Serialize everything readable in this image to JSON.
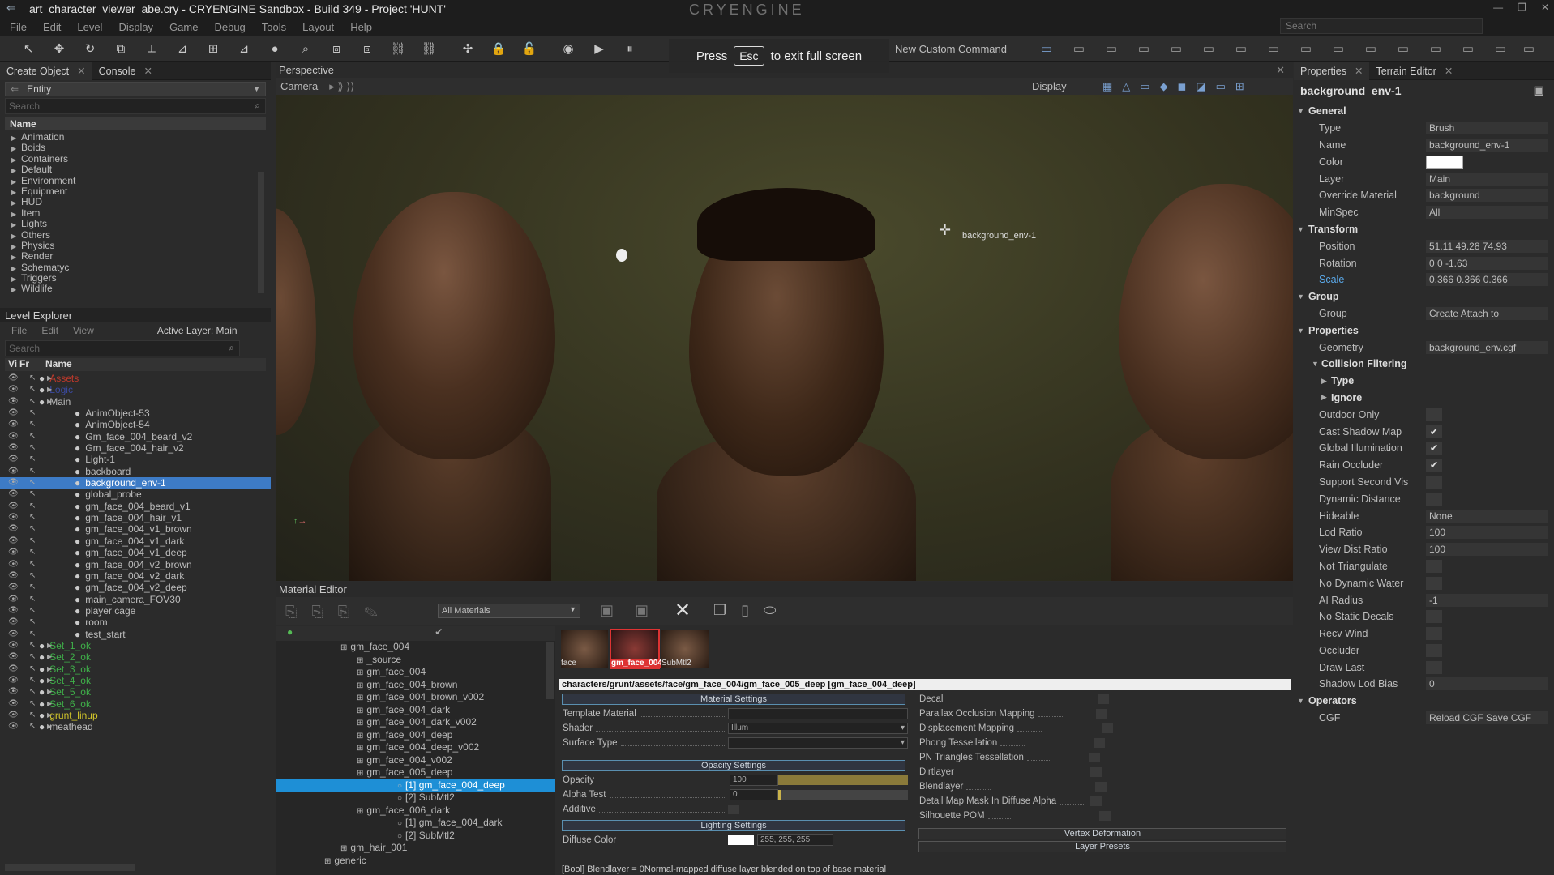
{
  "window": {
    "title": "art_character_viewer_abe.cry - CRYENGINE Sandbox - Build 349 - Project 'HUNT'",
    "logo": "CRYENGINE",
    "search_placeholder": "Search"
  },
  "menu": [
    "File",
    "Edit",
    "Level",
    "Display",
    "Game",
    "Debug",
    "Tools",
    "Layout",
    "Help"
  ],
  "toolbar": {
    "new_custom_command": "New Custom Command"
  },
  "fullscreen": {
    "press": "Press",
    "key": "Esc",
    "msg": "to exit full screen"
  },
  "create_object": {
    "tabs": [
      "Create Object",
      "Console"
    ],
    "dropdown": "Entity",
    "search": "Search",
    "col": "Name",
    "items": [
      "Animation",
      "Boids",
      "Containers",
      "Default",
      "Environment",
      "Equipment",
      "HUD",
      "Item",
      "Lights",
      "Others",
      "Physics",
      "Render",
      "Schematyc",
      "Triggers",
      "Wildlife"
    ]
  },
  "level_explorer": {
    "title": "Level Explorer",
    "menu": [
      "File",
      "Edit",
      "View"
    ],
    "active_layer": "Active Layer: Main",
    "search": "Search",
    "cols": [
      "Vi",
      "Fr",
      "Name"
    ],
    "items": [
      {
        "n": "Assets",
        "d": 0,
        "c": "#c0392b"
      },
      {
        "n": "Logic",
        "d": 0,
        "c": "#3b4aa0"
      },
      {
        "n": "Main",
        "d": 0,
        "c": "#bdbdbd"
      },
      {
        "n": "AnimObject-53",
        "d": 1
      },
      {
        "n": "AnimObject-54",
        "d": 1
      },
      {
        "n": "Gm_face_004_beard_v2",
        "d": 1
      },
      {
        "n": "Gm_face_004_hair_v2",
        "d": 1
      },
      {
        "n": "Light-1",
        "d": 1
      },
      {
        "n": "backboard",
        "d": 1
      },
      {
        "n": "background_env-1",
        "d": 1,
        "sel": true
      },
      {
        "n": "global_probe",
        "d": 1
      },
      {
        "n": "gm_face_004_beard_v1",
        "d": 1
      },
      {
        "n": "gm_face_004_hair_v1",
        "d": 1
      },
      {
        "n": "gm_face_004_v1_brown",
        "d": 1
      },
      {
        "n": "gm_face_004_v1_dark",
        "d": 1
      },
      {
        "n": "gm_face_004_v1_deep",
        "d": 1
      },
      {
        "n": "gm_face_004_v2_brown",
        "d": 1
      },
      {
        "n": "gm_face_004_v2_dark",
        "d": 1
      },
      {
        "n": "gm_face_004_v2_deep",
        "d": 1
      },
      {
        "n": "main_camera_FOV30",
        "d": 1
      },
      {
        "n": "player cage",
        "d": 1
      },
      {
        "n": "room",
        "d": 1
      },
      {
        "n": "test_start",
        "d": 1
      },
      {
        "n": "Set_1_ok",
        "d": 0,
        "c": "#3fae49"
      },
      {
        "n": "Set_2_ok",
        "d": 0,
        "c": "#3fae49"
      },
      {
        "n": "Set_3_ok",
        "d": 0,
        "c": "#3fae49"
      },
      {
        "n": "Set_4_ok",
        "d": 0,
        "c": "#3fae49"
      },
      {
        "n": "Set_5_ok",
        "d": 0,
        "c": "#3fae49"
      },
      {
        "n": "Set_6_ok",
        "d": 0,
        "c": "#3fae49"
      },
      {
        "n": "grunt_linup",
        "d": 0,
        "c": "#d4c72a"
      },
      {
        "n": "meathead",
        "d": 0
      }
    ]
  },
  "viewport": {
    "title": "Perspective",
    "camera": "Camera",
    "display": "Display",
    "label": "background_env-1"
  },
  "material_editor": {
    "title": "Material Editor",
    "filter": "All Materials",
    "tree": [
      {
        "n": "gm_face_004",
        "d": 0
      },
      {
        "n": "_source",
        "d": 1
      },
      {
        "n": "gm_face_004",
        "d": 1
      },
      {
        "n": "gm_face_004_brown",
        "d": 1
      },
      {
        "n": "gm_face_004_brown_v002",
        "d": 1
      },
      {
        "n": "gm_face_004_dark",
        "d": 1
      },
      {
        "n": "gm_face_004_dark_v002",
        "d": 1
      },
      {
        "n": "gm_face_004_deep",
        "d": 1
      },
      {
        "n": "gm_face_004_deep_v002",
        "d": 1
      },
      {
        "n": "gm_face_004_v002",
        "d": 1
      },
      {
        "n": "gm_face_005_deep",
        "d": 1
      },
      {
        "n": "[1] gm_face_004_deep",
        "d": 2,
        "sel": true
      },
      {
        "n": "[2] SubMtl2",
        "d": 2
      },
      {
        "n": "gm_face_006_dark",
        "d": 1
      },
      {
        "n": "[1] gm_face_004_dark",
        "d": 2
      },
      {
        "n": "[2] SubMtl2",
        "d": 2
      },
      {
        "n": "gm_hair_001",
        "d": 0
      },
      {
        "n": "generic",
        "d": -1
      }
    ],
    "thumbs": [
      "face",
      "gm_face_004",
      "SubMtl2"
    ],
    "path": "characters/grunt/assets/face/gm_face_004/gm_face_005_deep [gm_face_004_deep]",
    "sections": {
      "material": "Material Settings",
      "opacity": "Opacity Settings",
      "lighting": "Lighting Settings",
      "vertex": "Vertex Deformation",
      "layers": "Layer Presets"
    },
    "rows": {
      "template": "Template Material",
      "shader": "Shader",
      "shader_val": "Illum",
      "surface": "Surface Type",
      "opacity": "Opacity",
      "opacity_val": "100",
      "alpha": "Alpha Test",
      "alpha_val": "0",
      "additive": "Additive",
      "diffuse": "Diffuse Color",
      "diffuse_val": "255, 255, 255"
    },
    "right_rows": [
      "Decal",
      "Parallax Occlusion Mapping",
      "Displacement Mapping",
      "Phong Tessellation",
      "PN Triangles Tessellation",
      "Dirtlayer",
      "Blendlayer",
      "Detail Map Mask In Diffuse Alpha",
      "Silhouette POM"
    ],
    "status": "[Bool] Blendlayer = 0Normal-mapped diffuse layer blended on top of base material"
  },
  "properties": {
    "tabs": [
      "Properties",
      "Terrain Editor"
    ],
    "object": "background_env-1",
    "rows": [
      {
        "t": "sec",
        "l": "General"
      },
      {
        "l": "Type",
        "v": "Brush"
      },
      {
        "l": "Name",
        "v": "background_env-1"
      },
      {
        "l": "Color",
        "v": "",
        "swatch": true
      },
      {
        "l": "Layer",
        "v": "Main"
      },
      {
        "l": "Override Material",
        "v": "background"
      },
      {
        "l": "MinSpec",
        "v": "All"
      },
      {
        "t": "sec",
        "l": "Transform"
      },
      {
        "l": "Position",
        "v": "51.11   49.28   74.93"
      },
      {
        "l": "Rotation",
        "v": "0   0   -1.63"
      },
      {
        "l": "Scale",
        "v": "0.366   0.366   0.366",
        "blue": true
      },
      {
        "t": "sec",
        "l": "Group"
      },
      {
        "l": "Group",
        "v": "Create     Attach to"
      },
      {
        "t": "sec",
        "l": "Properties"
      },
      {
        "l": "Geometry",
        "v": "background_env.cgf"
      },
      {
        "t": "sub",
        "l": "Collision Filtering"
      },
      {
        "t": "sub2",
        "l": "Type"
      },
      {
        "t": "sub2",
        "l": "Ignore"
      },
      {
        "l": "Outdoor Only",
        "cb": ""
      },
      {
        "l": "Cast Shadow Map",
        "cb": "✔"
      },
      {
        "l": "Global Illumination",
        "cb": "✔"
      },
      {
        "l": "Rain Occluder",
        "cb": "✔"
      },
      {
        "l": "Support Second Vis",
        "cb": ""
      },
      {
        "l": "Dynamic Distance",
        "cb": ""
      },
      {
        "l": "Hideable",
        "v": "None"
      },
      {
        "l": "Lod Ratio",
        "v": "100"
      },
      {
        "l": "View Dist Ratio",
        "v": "100"
      },
      {
        "l": "Not Triangulate",
        "cb": ""
      },
      {
        "l": "No Dynamic Water",
        "cb": ""
      },
      {
        "l": "AI Radius",
        "v": "-1"
      },
      {
        "l": "No Static Decals",
        "cb": ""
      },
      {
        "l": "Recv Wind",
        "cb": ""
      },
      {
        "l": "Occluder",
        "cb": ""
      },
      {
        "l": "Draw Last",
        "cb": ""
      },
      {
        "l": "Shadow Lod Bias",
        "v": "0"
      },
      {
        "t": "sec",
        "l": "Operators"
      },
      {
        "l": "CGF",
        "v": "Reload CGF   Save CGF"
      }
    ]
  }
}
